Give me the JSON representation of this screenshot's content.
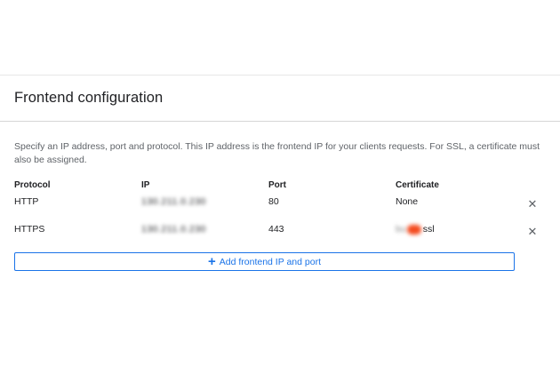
{
  "section": {
    "title": "Frontend configuration",
    "description": "Specify an IP address, port and protocol. This IP address is the frontend IP for your clients requests. For SSL, a certificate must also be assigned."
  },
  "table": {
    "headers": [
      "Protocol",
      "IP",
      "Port",
      "Certificate"
    ],
    "rows": [
      {
        "protocol": "HTTP",
        "ip": "130.211.0.230",
        "port": "80",
        "certificate": "None",
        "certificate_suffix": ""
      },
      {
        "protocol": "HTTPS",
        "ip": "130.211.0.230",
        "port": "443",
        "certificate": "",
        "certificate_suffix": "ssl"
      }
    ],
    "remove_icon": "close-icon"
  },
  "actions": {
    "add_label": "Add frontend IP and port",
    "add_icon": "plus-icon"
  },
  "colors": {
    "accent": "#1a73e8",
    "redaction": "#f44a1e"
  }
}
